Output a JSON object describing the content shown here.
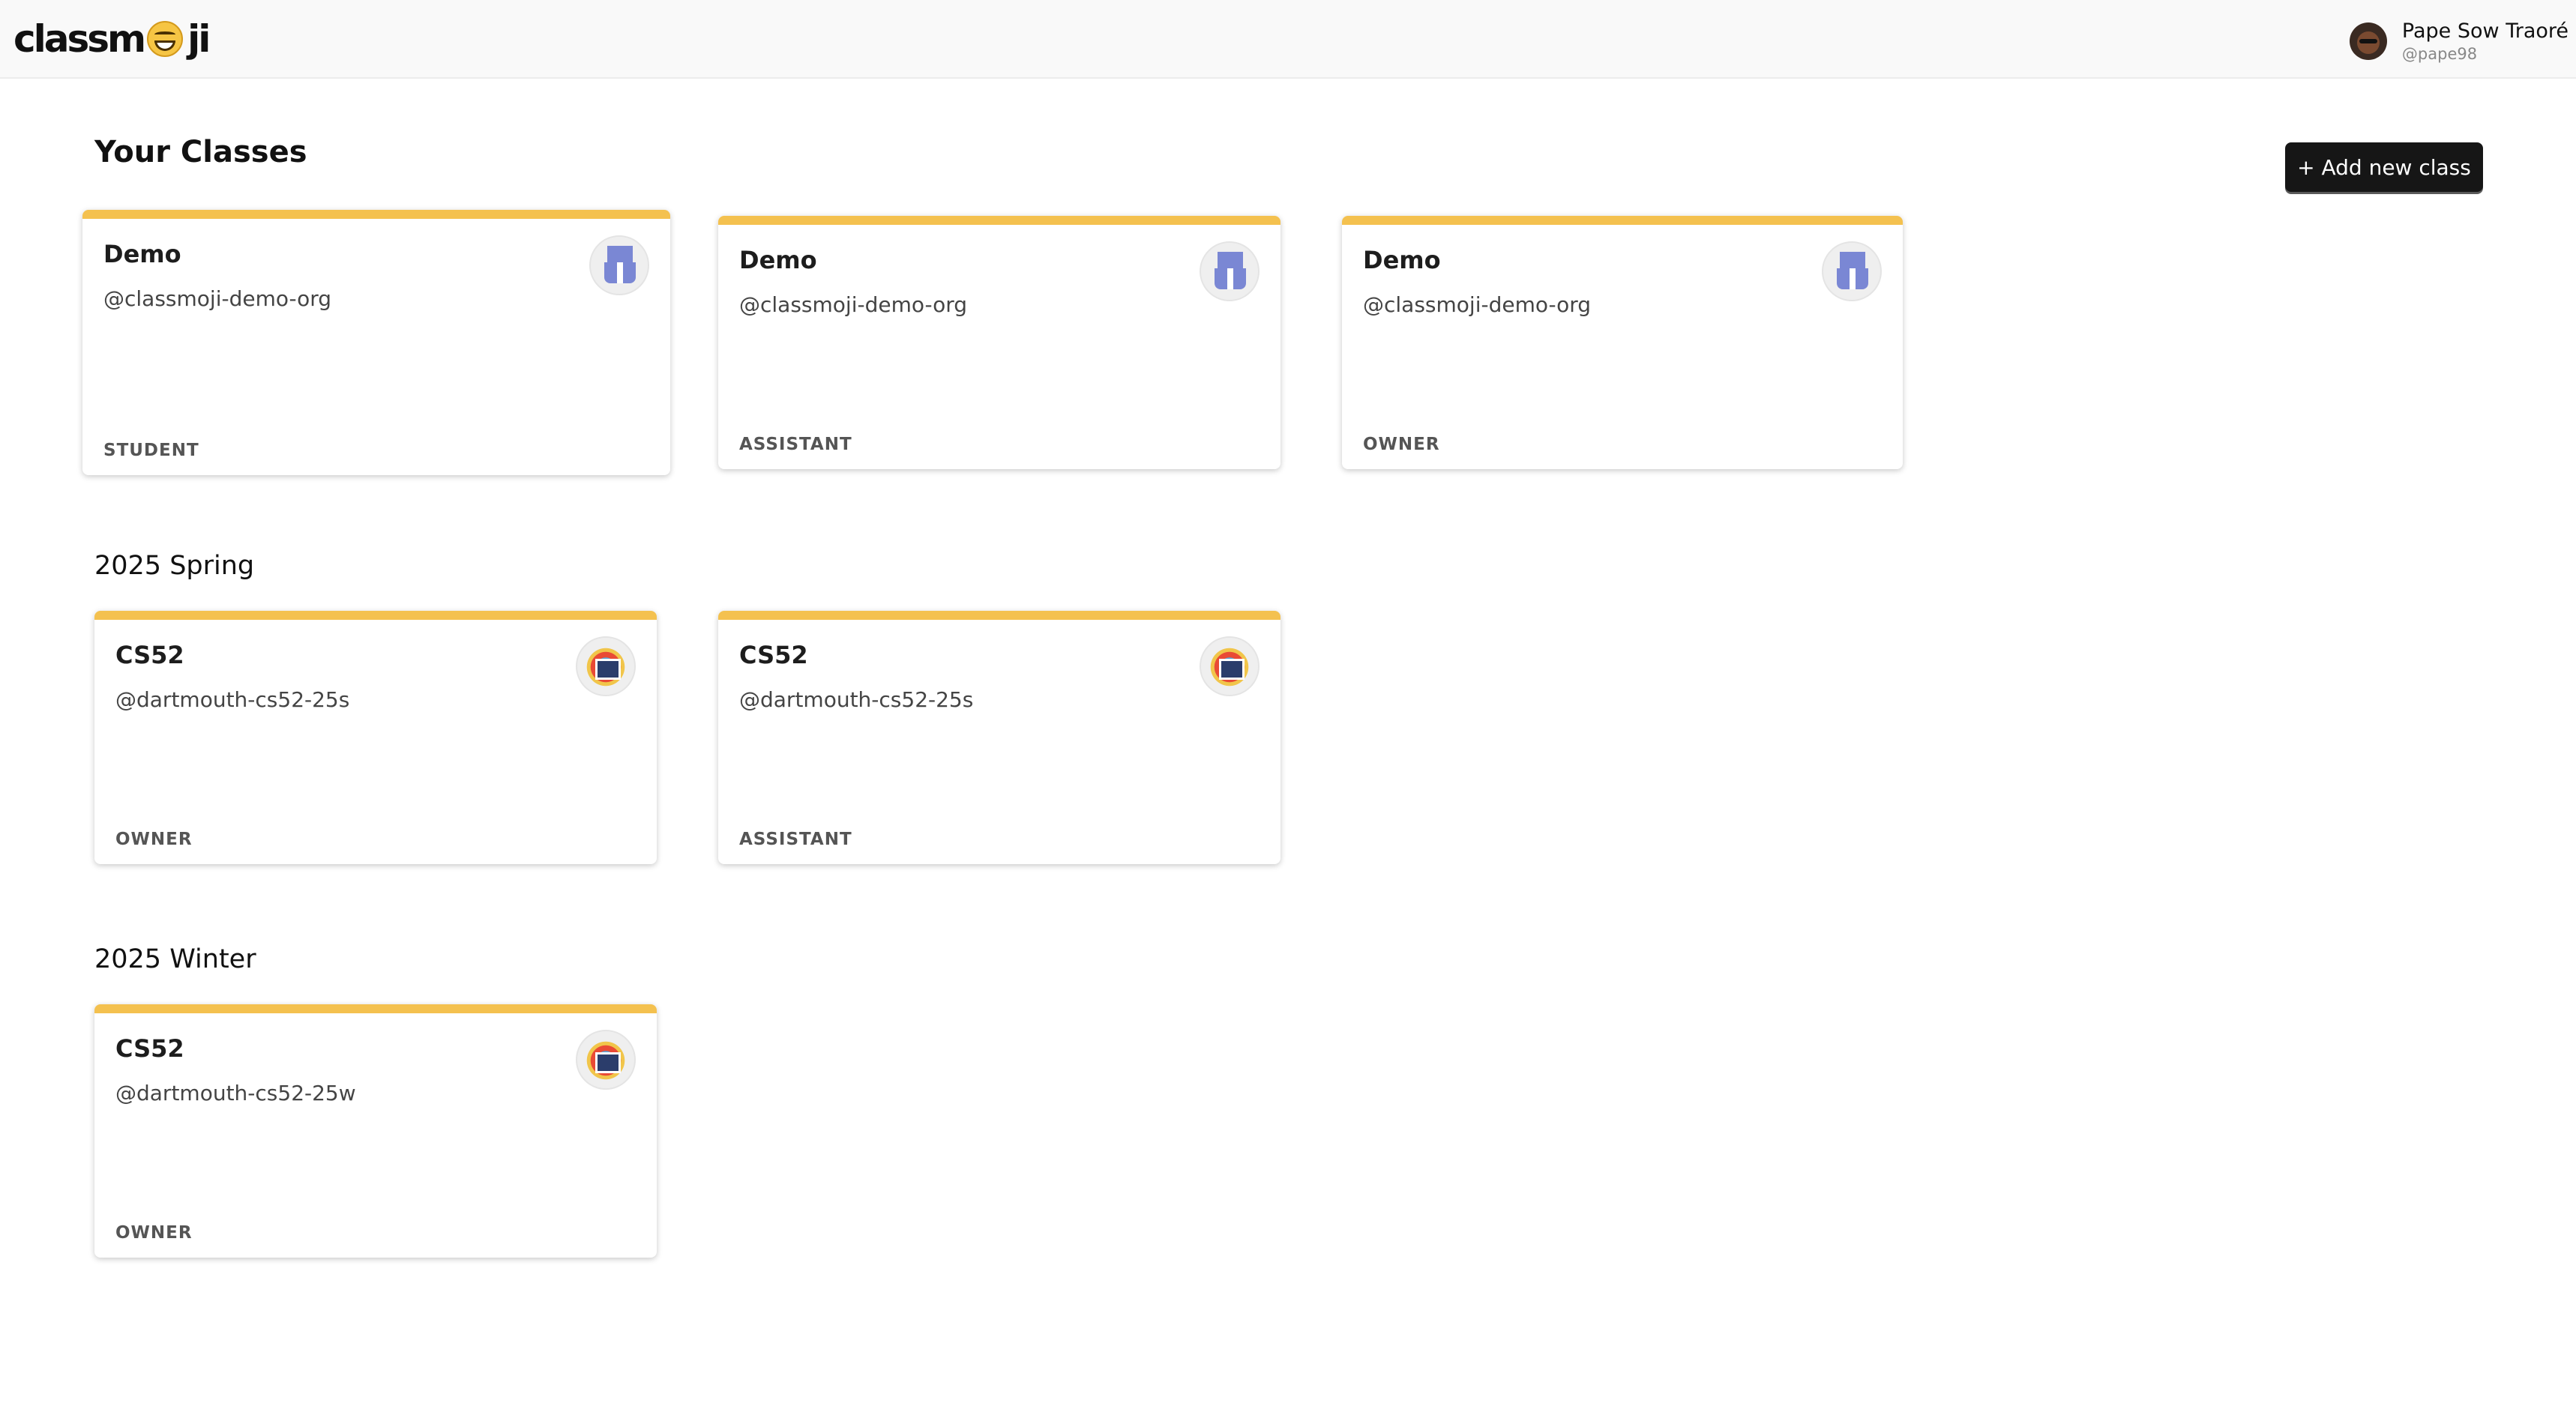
{
  "header": {
    "logo_left": "classm",
    "logo_right": "ji",
    "emoji_icon": "grinning-sweat-emoji-icon",
    "user": {
      "name": "Pape Sow Traoré",
      "handle": "@pape98"
    }
  },
  "main": {
    "title": "Your Classes",
    "add_button_label": "+ Add new class"
  },
  "groups": [
    {
      "heading": "",
      "cards": [
        {
          "title": "Demo",
          "org": "@classmoji-demo-org",
          "role": "STUDENT"
        },
        {
          "title": "Demo",
          "org": "@classmoji-demo-org",
          "role": "ASSISTANT"
        },
        {
          "title": "Demo",
          "org": "@classmoji-demo-org",
          "role": "OWNER"
        }
      ]
    },
    {
      "heading": "2025 Spring",
      "cards": [
        {
          "title": "CS52",
          "org": "@dartmouth-cs52-25s",
          "role": "OWNER"
        },
        {
          "title": "CS52",
          "org": "@dartmouth-cs52-25s",
          "role": "ASSISTANT"
        }
      ]
    },
    {
      "heading": "2025 Winter",
      "cards": [
        {
          "title": "CS52",
          "org": "@dartmouth-cs52-25w",
          "role": "OWNER"
        }
      ]
    }
  ],
  "colors": {
    "card_accent": "#f4c14f",
    "button_bg": "#161616"
  }
}
